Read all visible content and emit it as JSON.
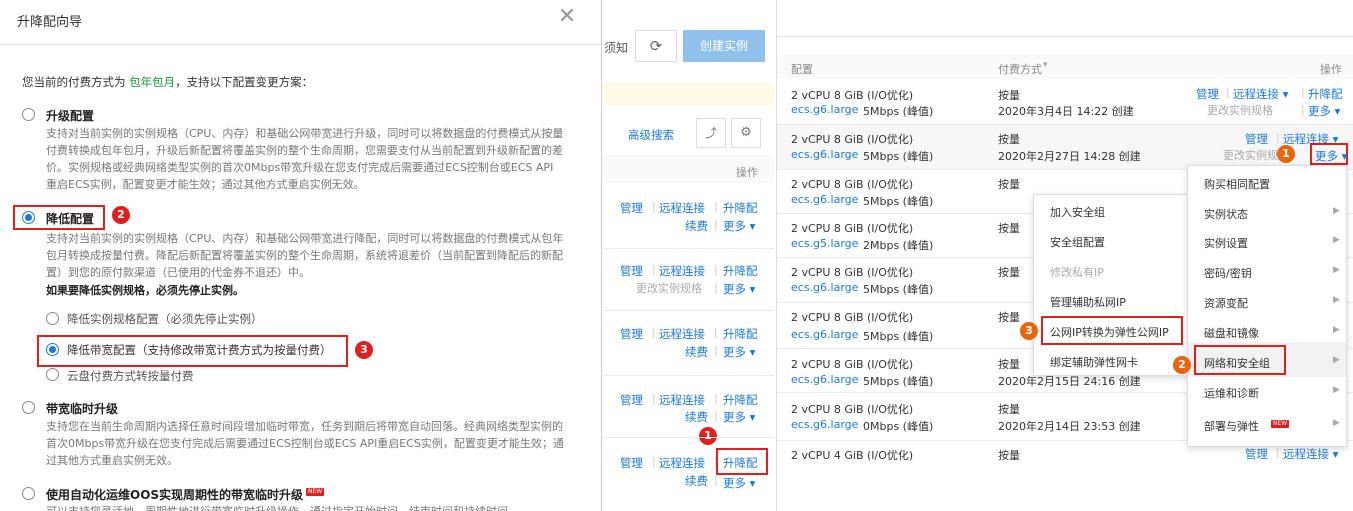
{
  "wizard": {
    "title": "升降配向导",
    "intro_prefix": "您当前的付费方式为",
    "intro_highlight": "包年包月",
    "intro_suffix": "，支持以下配置变更方案：",
    "options": [
      {
        "title": "升级配置",
        "desc": "支持对当前实例的实例规格（CPU、内存）和基础公网带宽进行升级，同时可以将数据盘的付费模式从按量付费转换成包年包月，升级后新配置将覆盖实例的整个生命周期，您需要支付从当前配置到升级新配置的差价。实例规格或经典网络类型实例的首次0Mbps带宽升级在您支付完成后需要通过ECS控制台或ECS API重启ECS实例，配置变更才能生效；通过其他方式重启实例无效。"
      },
      {
        "title": "降低配置",
        "desc": "支持对当前实例的实例规格（CPU、内存）和基础公网带宽进行降配，同时可以将数据盘的付费模式从包年包月转换成按量付费。降配后新配置将覆盖实例的整个生命周期，系统将退差价（当前配置到降配后的新配置）到您的原付款渠道（已使用的代金券不退还）中。",
        "desc_bold": "如果要降低实例规格，必须先停止实例。"
      },
      {
        "title": "带宽临时升级",
        "desc": "支持您在当前生命周期内选择任意时间段增加临时带宽，任务到期后将带宽自动回落。经典网络类型实例的首次0Mbps带宽升级在您支付完成后需要通过ECS控制台或ECS API重启ECS实例，配置变更才能生效；通过其他方式重启实例无效。"
      },
      {
        "title": "使用自动化运维OOS实现周期性的带宽临时升级",
        "desc": "可以支持您灵活地、周期性地进行带宽临时升级操作，通过指定开始时间、结束时间和持续时间"
      }
    ],
    "sub_options": [
      "降低实例规格配置（必须先停止实例）",
      "降低带宽配置（支持修改带宽计费方式为按量付费）",
      "云盘付费方式转按量付费"
    ],
    "badge_2": "2",
    "badge_3": "3",
    "new_tag": "NEW"
  },
  "middle": {
    "notice": "须知",
    "create_button": "创建实例",
    "advanced_search": "高级搜索",
    "ops_header": "操作",
    "manage": "管理",
    "remote": "远程连接",
    "upgrade": "升降配",
    "renew": "续费",
    "more": "更多",
    "change_spec": "更改实例规格",
    "badge_1": "1"
  },
  "right": {
    "headers": {
      "config": "配置",
      "payment": "付费方式",
      "ops": "操作"
    },
    "rows": [
      {
        "cfg": "2 vCPU 8 GiB (I/O优化)",
        "type": "ecs.g6.large",
        "bw": "5Mbps (峰值)",
        "pay": "按量",
        "created": "2020年3月4日 14:22 创建"
      },
      {
        "cfg": "2 vCPU 8 GiB (I/O优化)",
        "type": "ecs.g6.large",
        "bw": "5Mbps (峰值)",
        "pay": "按量",
        "created": "2020年2月27日 14:28 创建"
      },
      {
        "cfg": "2 vCPU 8 GiB (I/O优化)",
        "type": "ecs.g6.large",
        "bw": "5Mbps (峰值)",
        "pay": "按量",
        "created": ""
      },
      {
        "cfg": "2 vCPU 8 GiB (I/O优化)",
        "type": "ecs.g5.large",
        "bw": "2Mbps (峰值)",
        "pay": "按量",
        "created": ""
      },
      {
        "cfg": "2 vCPU 8 GiB (I/O优化)",
        "type": "ecs.g6.large",
        "bw": "5Mbps (峰值)",
        "pay": "按量",
        "created": ""
      },
      {
        "cfg": "2 vCPU 8 GiB (I/O优化)",
        "type": "ecs.g6.large",
        "bw": "5Mbps (峰值)",
        "pay": "按量",
        "created": ""
      },
      {
        "cfg": "2 vCPU 8 GiB (I/O优化)",
        "type": "ecs.g6.large",
        "bw": "5Mbps (峰值)",
        "pay": "按量",
        "created": "2020年2月15日 24:16 创建"
      },
      {
        "cfg": "2 vCPU 8 GiB (I/O优化)",
        "type": "ecs.g6.large",
        "bw": "0Mbps (峰值)",
        "pay": "按量",
        "created": "2020年2月14日 23:53 创建"
      },
      {
        "cfg": "2 vCPU 4 GiB (I/O优化)",
        "type": "",
        "bw": "",
        "pay": "按量",
        "created": ""
      }
    ],
    "manage": "管理",
    "remote": "远程连接",
    "upgrade": "升降配",
    "change_spec": "更改实例规格",
    "more": "更多",
    "badge_1": "1",
    "badge_2": "2",
    "badge_3": "3",
    "main_menu": [
      "购买相同配置",
      "实例状态",
      "实例设置",
      "密码/密钥",
      "资源变配",
      "磁盘和镜像",
      "网络和安全组",
      "运维和诊断",
      "部署与弹性"
    ],
    "sub_menu": [
      "加入安全组",
      "安全组配置",
      "修改私有IP",
      "管理辅助私网IP",
      "公网IP转换为弹性公网IP",
      "绑定辅助弹性网卡"
    ],
    "new_tag": "NEW"
  }
}
